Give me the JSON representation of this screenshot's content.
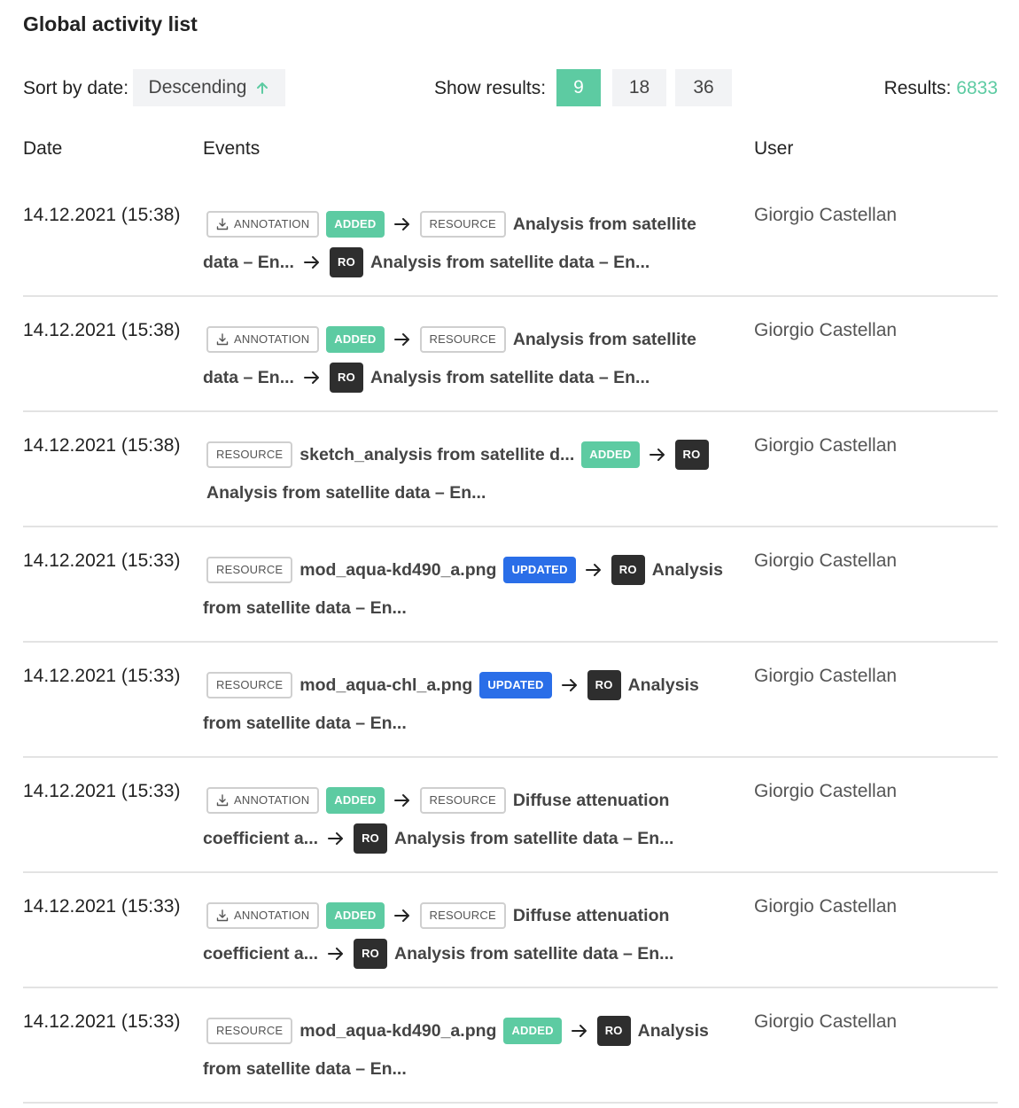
{
  "title": "Global activity list",
  "controls": {
    "sort_label": "Sort by date:",
    "sort_value": "Descending",
    "show_label": "Show results:",
    "page_sizes": [
      "9",
      "18",
      "36"
    ],
    "active_page_size": "9",
    "results_label": "Results:",
    "results_count": "6833"
  },
  "columns": {
    "date": "Date",
    "events": "Events",
    "user": "User"
  },
  "colors": {
    "accent": "#5dcba2",
    "updated": "#2a6ee8",
    "ro": "#2e2e2e"
  },
  "rows": [
    {
      "date": "14.12.2021 (15:38)",
      "user": "Giorgio Castellan",
      "parts": [
        {
          "kind": "badge-outline",
          "icon": "download-icon",
          "text": "ANNOTATION"
        },
        {
          "kind": "badge-added",
          "text": "ADDED"
        },
        {
          "kind": "arrow"
        },
        {
          "kind": "badge-outline",
          "text": "RESOURCE"
        },
        {
          "kind": "text",
          "text": "Analysis from satellite data – En..."
        },
        {
          "kind": "arrow"
        },
        {
          "kind": "badge-ro",
          "text": "RO"
        },
        {
          "kind": "text",
          "text": "Analysis from satellite data – En..."
        }
      ]
    },
    {
      "date": "14.12.2021 (15:38)",
      "user": "Giorgio Castellan",
      "parts": [
        {
          "kind": "badge-outline",
          "icon": "download-icon",
          "text": "ANNOTATION"
        },
        {
          "kind": "badge-added",
          "text": "ADDED"
        },
        {
          "kind": "arrow"
        },
        {
          "kind": "badge-outline",
          "text": "RESOURCE"
        },
        {
          "kind": "text",
          "text": "Analysis from satellite data – En..."
        },
        {
          "kind": "arrow"
        },
        {
          "kind": "badge-ro",
          "text": "RO"
        },
        {
          "kind": "text",
          "text": "Analysis from satellite data – En..."
        }
      ]
    },
    {
      "date": "14.12.2021 (15:38)",
      "user": "Giorgio Castellan",
      "parts": [
        {
          "kind": "badge-outline",
          "text": "RESOURCE"
        },
        {
          "kind": "text",
          "text": "sketch_analysis from satellite d..."
        },
        {
          "kind": "badge-added",
          "text": "ADDED"
        },
        {
          "kind": "arrow"
        },
        {
          "kind": "badge-ro",
          "text": "RO"
        },
        {
          "kind": "text",
          "text": "Analysis from satellite data – En..."
        }
      ]
    },
    {
      "date": "14.12.2021 (15:33)",
      "user": "Giorgio Castellan",
      "parts": [
        {
          "kind": "badge-outline",
          "text": "RESOURCE"
        },
        {
          "kind": "text",
          "text": "mod_aqua-kd490_a.png"
        },
        {
          "kind": "badge-updated",
          "text": "UPDATED"
        },
        {
          "kind": "arrow"
        },
        {
          "kind": "badge-ro",
          "text": "RO"
        },
        {
          "kind": "text",
          "text": "Analysis from satellite data – En..."
        }
      ]
    },
    {
      "date": "14.12.2021 (15:33)",
      "user": "Giorgio Castellan",
      "parts": [
        {
          "kind": "badge-outline",
          "text": "RESOURCE"
        },
        {
          "kind": "text",
          "text": "mod_aqua-chl_a.png"
        },
        {
          "kind": "badge-updated",
          "text": "UPDATED"
        },
        {
          "kind": "arrow"
        },
        {
          "kind": "badge-ro",
          "text": "RO"
        },
        {
          "kind": "text",
          "text": "Analysis from satellite data – En..."
        }
      ]
    },
    {
      "date": "14.12.2021 (15:33)",
      "user": "Giorgio Castellan",
      "parts": [
        {
          "kind": "badge-outline",
          "icon": "download-icon",
          "text": "ANNOTATION"
        },
        {
          "kind": "badge-added",
          "text": "ADDED"
        },
        {
          "kind": "arrow"
        },
        {
          "kind": "badge-outline",
          "text": "RESOURCE"
        },
        {
          "kind": "text",
          "text": "Diffuse attenuation coefficient a..."
        },
        {
          "kind": "arrow"
        },
        {
          "kind": "badge-ro",
          "text": "RO"
        },
        {
          "kind": "text",
          "text": "Analysis from satellite data – En..."
        }
      ]
    },
    {
      "date": "14.12.2021 (15:33)",
      "user": "Giorgio Castellan",
      "parts": [
        {
          "kind": "badge-outline",
          "icon": "download-icon",
          "text": "ANNOTATION"
        },
        {
          "kind": "badge-added",
          "text": "ADDED"
        },
        {
          "kind": "arrow"
        },
        {
          "kind": "badge-outline",
          "text": "RESOURCE"
        },
        {
          "kind": "text",
          "text": "Diffuse attenuation coefficient a..."
        },
        {
          "kind": "arrow"
        },
        {
          "kind": "badge-ro",
          "text": "RO"
        },
        {
          "kind": "text",
          "text": "Analysis from satellite data – En..."
        }
      ]
    },
    {
      "date": "14.12.2021 (15:33)",
      "user": "Giorgio Castellan",
      "parts": [
        {
          "kind": "badge-outline",
          "text": "RESOURCE"
        },
        {
          "kind": "text",
          "text": "mod_aqua-kd490_a.png"
        },
        {
          "kind": "badge-added",
          "text": "ADDED"
        },
        {
          "kind": "arrow"
        },
        {
          "kind": "badge-ro",
          "text": "RO"
        },
        {
          "kind": "text",
          "text": "Analysis from satellite data – En..."
        }
      ]
    }
  ]
}
